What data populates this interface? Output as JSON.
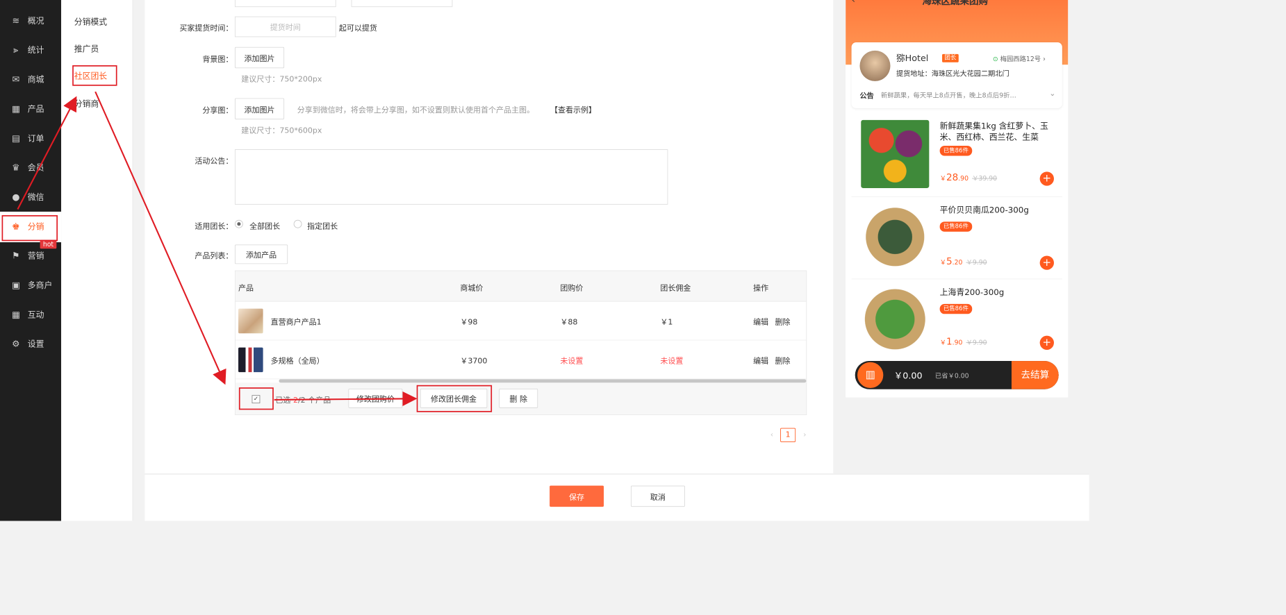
{
  "sidebar": {
    "items": [
      {
        "label": "概况",
        "icon": "layers-icon"
      },
      {
        "label": "统计",
        "icon": "chart-icon"
      },
      {
        "label": "商城",
        "icon": "mail-icon"
      },
      {
        "label": "产品",
        "icon": "grid-icon"
      },
      {
        "label": "订单",
        "icon": "clipboard-icon"
      },
      {
        "label": "会员",
        "icon": "crown-icon"
      },
      {
        "label": "微信",
        "icon": "chat-icon"
      },
      {
        "label": "分销",
        "icon": "users-icon"
      },
      {
        "label": "营销",
        "icon": "flag-icon"
      },
      {
        "label": "多商户",
        "icon": "shop-icon"
      },
      {
        "label": "互动",
        "icon": "grid-icon"
      },
      {
        "label": "设置",
        "icon": "gear-icon"
      }
    ],
    "hot_badge": "hot"
  },
  "submenu": {
    "items": [
      "分销模式",
      "推广员",
      "社区团长",
      "分销商"
    ]
  },
  "form": {
    "pickup_label": "买家提货时间：",
    "pickup_placeholder": "提货时间",
    "pickup_suffix": "起可以提货",
    "bg_label": "背景图：",
    "add_image": "添加图片",
    "bg_hint": "建议尺寸：750*200px",
    "share_label": "分享图：",
    "share_desc": "分享到微信时，将会带上分享图，如不设置则默认使用首个产品主图。",
    "share_example": "【查看示例】",
    "share_hint": "建议尺寸：750*600px",
    "notice_label": "活动公告：",
    "leader_label": "适用团长：",
    "leader_all": "全部团长",
    "leader_specific": "指定团长",
    "products_label": "产品列表：",
    "add_product": "添加产品"
  },
  "table": {
    "columns": [
      "产品",
      "商城价",
      "团购价",
      "团长佣金",
      "操作"
    ],
    "rows": [
      {
        "name": "直营商户产品1",
        "mall_price": "￥98",
        "group_price": "￥88",
        "commission": "￥1",
        "edit": "编辑",
        "delete": "删除"
      },
      {
        "name": "多规格（全局）",
        "mall_price": "￥3700",
        "group_price": "未设置",
        "commission": "未设置",
        "edit": "编辑",
        "delete": "删除"
      }
    ],
    "selected_prefix": "已选",
    "selected_count": "2",
    "selected_suffix": "/2 个产品",
    "btn_group_price": "修改团购价",
    "btn_commission": "修改团长佣金",
    "btn_delete": "删 除",
    "page": "1"
  },
  "footer": {
    "save": "保存",
    "cancel": "取消"
  },
  "phone": {
    "title": "海珠区蔬果团购",
    "leader_name": "猕Hotel",
    "leader_tag": "团长",
    "address_short": "梅园西路12号",
    "pickup": "提货地址：海珠区光大花园二期北门",
    "notice_label": "公告",
    "notice": "新鲜蔬果，每天早上8点开售，晚上8点后9折…",
    "products": [
      {
        "name": "新鲜蔬果集1kg 含红萝卜、玉米、西红柿、西兰花、生菜",
        "sold": "已售86件",
        "price_int": "28",
        "price_dec": ".90",
        "orig": "￥39.90"
      },
      {
        "name": "平价贝贝南瓜200-300g",
        "sold": "已售86件",
        "price_int": "5",
        "price_dec": ".20",
        "orig": "￥9.90"
      },
      {
        "name": "上海青200-300g",
        "sold": "已售86件",
        "price_int": "1",
        "price_dec": ".90",
        "orig": "￥9.90"
      }
    ],
    "cart_total": "￥0.00",
    "cart_saved": "已省￥0.00",
    "checkout": "去结算",
    "currency": "￥"
  }
}
